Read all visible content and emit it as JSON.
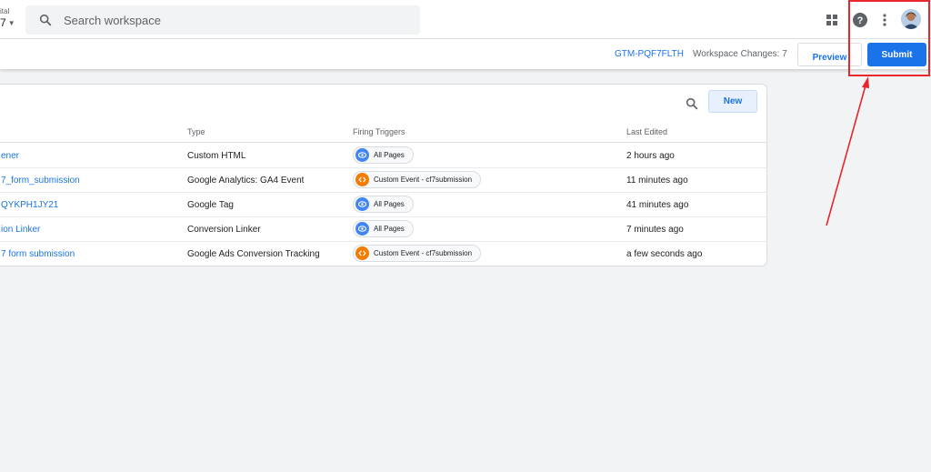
{
  "account": {
    "line1": "ital",
    "line2": "7"
  },
  "search": {
    "placeholder": "Search workspace"
  },
  "icons": {
    "apps": "apps-grid-icon",
    "help": "help-circle-icon",
    "more": "more-vert-icon",
    "search": "search-icon"
  },
  "subbar": {
    "container_id": "GTM-PQF7FLTH",
    "workspace_changes": "Workspace Changes: 7",
    "preview_label": "Preview",
    "submit_label": "Submit"
  },
  "tags": {
    "new_label": "New",
    "columns": {
      "type": "Type",
      "firing_triggers": "Firing Triggers",
      "last_edited": "Last Edited"
    },
    "rows": [
      {
        "name": "ener",
        "type": "Custom HTML",
        "trigger": "All Pages",
        "trigger_kind": "pageview",
        "last_edited": "2 hours ago"
      },
      {
        "name": "7_form_submission",
        "type": "Google Analytics: GA4 Event",
        "trigger": "Custom Event - cf7submission",
        "trigger_kind": "custom",
        "last_edited": "11 minutes ago"
      },
      {
        "name": "QYKPH1JY21",
        "type": "Google Tag",
        "trigger": "All Pages",
        "trigger_kind": "pageview",
        "last_edited": "41 minutes ago"
      },
      {
        "name": "ion Linker",
        "type": "Conversion Linker",
        "trigger": "All Pages",
        "trigger_kind": "pageview",
        "last_edited": "7 minutes ago"
      },
      {
        "name": "7 form submission",
        "type": "Google Ads Conversion Tracking",
        "trigger": "Custom Event - cf7submission",
        "trigger_kind": "custom",
        "last_edited": "a few seconds ago"
      }
    ]
  },
  "colors": {
    "accent": "#1a73e8",
    "annotation": "#e8262c",
    "pageview_trigger": "#4285f4",
    "custom_trigger": "#f57c00"
  }
}
